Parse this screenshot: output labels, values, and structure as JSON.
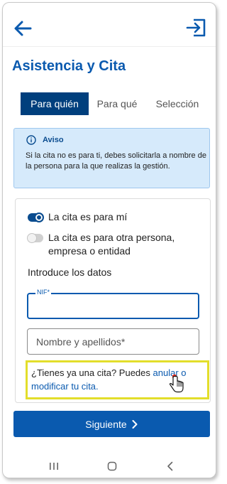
{
  "header": {
    "back_icon": "arrow-left-icon",
    "logout_icon": "logout-icon",
    "title": "Asistencia y Cita"
  },
  "tabs": [
    {
      "label": "Para quién",
      "active": true
    },
    {
      "label": "Para qué",
      "active": false
    },
    {
      "label": "Selección",
      "active": false
    }
  ],
  "alert": {
    "icon": "info-icon",
    "title": "Aviso",
    "text": "Si la cita no es para ti, debes solicitarla a nombre de la persona para la que realizas la gestión."
  },
  "form": {
    "toggle_self": {
      "label": "La cita es para mí",
      "on": true
    },
    "toggle_other": {
      "label": "La cita es para otra persona, empresa o entidad",
      "on": false
    },
    "section_label": "Introduce los datos",
    "nif_label": "NIF*",
    "nif_value": "",
    "name_placeholder": "Nombre y apellidos*",
    "existing_prefix": "¿Tienes ya una cita? Puedes ",
    "existing_link": "anular o modificar tu cita."
  },
  "next_button": {
    "label": "Siguiente",
    "icon": "chevron-right-icon"
  },
  "navbar": {
    "icons": [
      "recent-apps-icon",
      "home-icon",
      "back-icon"
    ]
  },
  "colors": {
    "primary": "#0a5aaf",
    "tab_active": "#003f7d",
    "alert_bg": "#d6eafb",
    "highlight_border": "#e3de2b"
  }
}
